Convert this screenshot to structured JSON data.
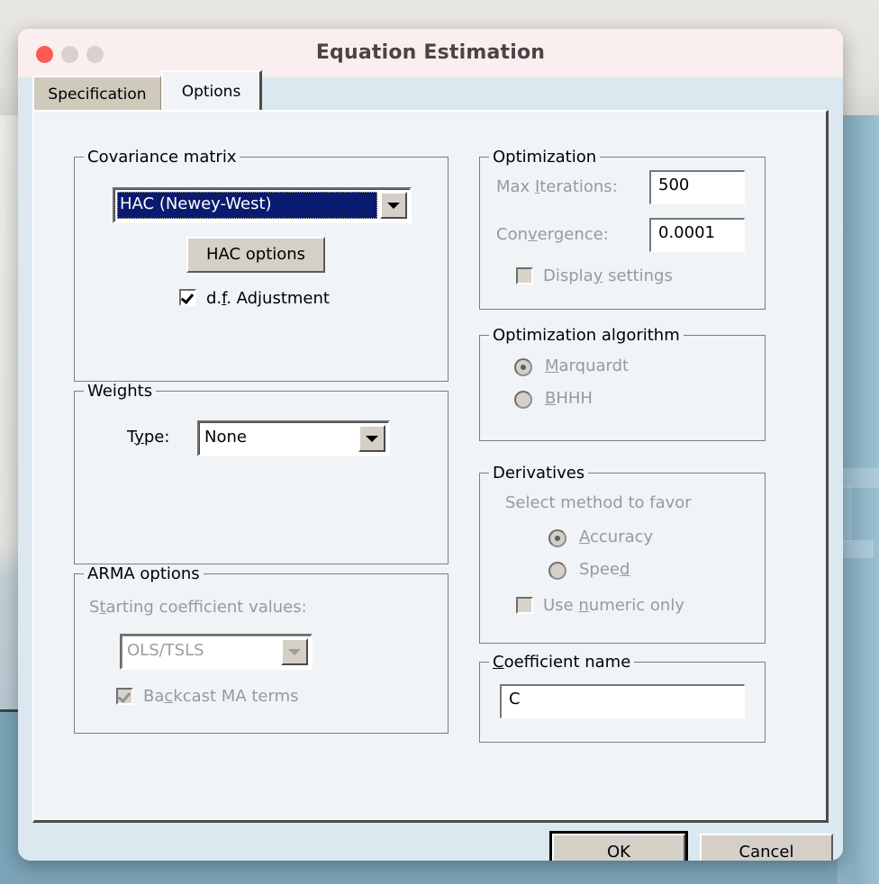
{
  "window": {
    "title": "Equation Estimation",
    "traffic_lights": [
      "close",
      "minimize",
      "maximize"
    ]
  },
  "tabs": [
    {
      "label": "Specification",
      "active": false
    },
    {
      "label": "Options",
      "active": true
    }
  ],
  "groups": {
    "covariance_matrix": {
      "legend": "Covariance matrix",
      "combo_value": "HAC (Newey-West)",
      "button_label": "HAC options",
      "checkbox_label": "d.f. Adjustment",
      "checkbox_checked": "checked"
    },
    "weights": {
      "legend": "Weights",
      "type_label": "Type:",
      "combo_value": "None"
    },
    "arma_options": {
      "legend": "ARMA options",
      "starting_label": "Starting coefficient values:",
      "combo_value": "OLS/TSLS",
      "checkbox_label": "Backcast MA terms",
      "checkbox_checked": "checked"
    },
    "optimization": {
      "legend": "Optimization",
      "max_iterations_label": "Max Iterations:",
      "max_iterations_value": "500",
      "convergence_label": "Convergence:",
      "convergence_value": "0.0001",
      "display_settings_label": "Display settings",
      "display_settings_checked": "unchecked"
    },
    "optimization_algorithm": {
      "legend": "Optimization algorithm",
      "options": [
        {
          "label": "Marquardt",
          "selected": true
        },
        {
          "label": "BHHH",
          "selected": false
        }
      ]
    },
    "derivatives": {
      "legend": "Derivatives",
      "hint": "Select method to favor",
      "options": [
        {
          "label": "Accuracy",
          "selected": true
        },
        {
          "label": "Speed",
          "selected": false
        }
      ],
      "numeric_label": "Use numeric only",
      "numeric_checked": "unchecked"
    },
    "coefficient_name": {
      "legend": "Coefficient name",
      "value": "C"
    }
  },
  "footer": {
    "ok_label": "OK",
    "cancel_label": "Cancel"
  },
  "colors": {
    "titlebar": "#fbeeee",
    "dialog_body": "#dbe8ef",
    "tab_body": "#f0f4f7",
    "selection_blue": "#0a1a6e",
    "button_face": "#d4d0c8",
    "disabled_text": "#969a9d",
    "close_red": "#fc5b52",
    "desktop": "#7ba4b8"
  }
}
